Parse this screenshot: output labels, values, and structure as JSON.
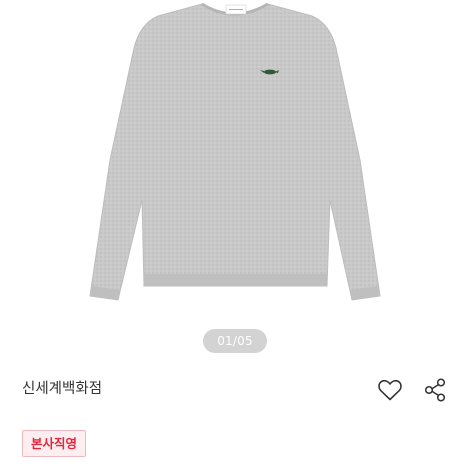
{
  "gallery": {
    "brand_tag_text": "LACOSTE",
    "page_indicator": "01/05",
    "colors": {
      "sweater": "#c7c7c7",
      "background": "#ffffff"
    }
  },
  "seller": {
    "name": "신세계백화점",
    "heart_icon": "heart-outline",
    "share_icon": "share-nodes"
  },
  "badge": {
    "label": "본사직영",
    "colors": {
      "text": "#e4253a",
      "background": "#fdeff1",
      "border": "#f2b8bf"
    }
  }
}
